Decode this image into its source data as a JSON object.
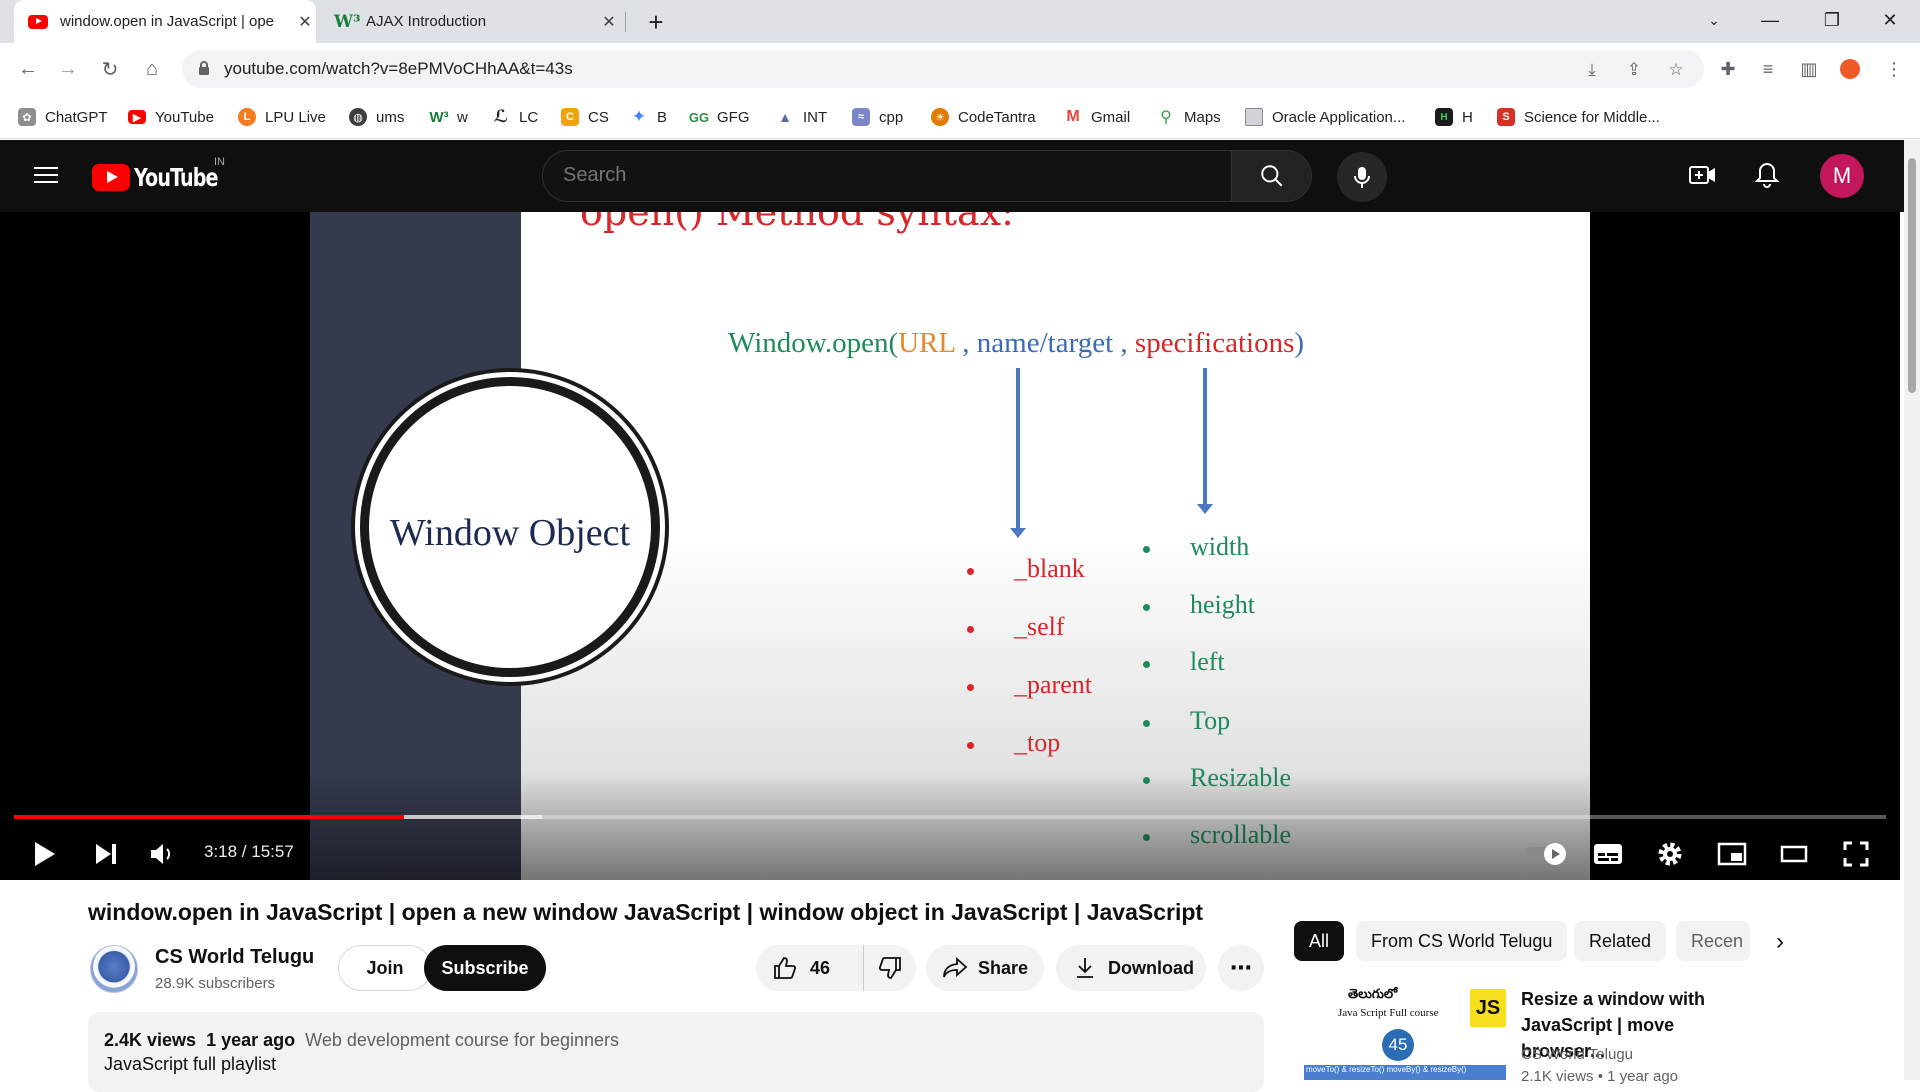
{
  "browser": {
    "tabs": [
      {
        "title": "window.open in JavaScript | ope",
        "active": true
      },
      {
        "title": "AJAX Introduction",
        "active": false
      }
    ],
    "new_tab": "+",
    "url": "youtube.com/watch?v=8ePMVoCHhAA&t=43s",
    "bookmarks": [
      {
        "label": "ChatGPT",
        "icon": "chatgpt-icon",
        "color": "#6f6f6f"
      },
      {
        "label": "YouTube",
        "icon": "youtube-icon",
        "color": "#ff0000"
      },
      {
        "label": "LPU Live",
        "icon": "lpu-icon",
        "color": "#f47b20"
      },
      {
        "label": "ums",
        "icon": "globe-icon",
        "color": "#3c4043"
      },
      {
        "label": "w",
        "icon": "w3-icon",
        "color": "#1a7f37"
      },
      {
        "label": "LC",
        "icon": "leetcode-icon",
        "color": "#202124"
      },
      {
        "label": "CS",
        "icon": "cs-icon",
        "color": "#f0a30a"
      },
      {
        "label": "B",
        "icon": "bard-icon",
        "color": "#4285f4"
      },
      {
        "label": "GFG",
        "icon": "gfg-icon",
        "color": "#2f8d46"
      },
      {
        "label": "INT",
        "icon": "int-icon",
        "color": "#5b6e9c"
      },
      {
        "label": "cpp",
        "icon": "cpp-icon",
        "color": "#6a5acd"
      },
      {
        "label": "CodeTantra",
        "icon": "codetantra-icon",
        "color": "#e07b00"
      },
      {
        "label": "Gmail",
        "icon": "gmail-icon",
        "color": "#ea4335"
      },
      {
        "label": "Maps",
        "icon": "maps-icon",
        "color": "#34a853"
      },
      {
        "label": "Oracle Application...",
        "icon": "oracle-icon",
        "color": "#8a8a8a"
      },
      {
        "label": "H",
        "icon": "hackerrank-icon",
        "color": "#1b1b1b"
      },
      {
        "label": "Science for Middle...",
        "icon": "science-icon",
        "color": "#d93025"
      }
    ]
  },
  "youtube": {
    "logo": "YouTube",
    "region": "IN",
    "search_placeholder": "Search",
    "avatar_letter": "M",
    "avatar_color": "#c2185b"
  },
  "slide": {
    "title": "open() Method syntax:",
    "circle_label": "Window Object",
    "syntax": {
      "prefix": "Window.open(",
      "url": "URL",
      "sep1": " , ",
      "name": "name/target",
      "sep2": " , ",
      "spec": "specifications",
      "suffix": ")"
    },
    "targets": [
      "_blank",
      "_self",
      "_parent",
      "_top"
    ],
    "specs": [
      "width",
      "height",
      "left",
      "Top",
      "Resizable",
      "scrollable"
    ],
    "colors": {
      "red": "#d8262b",
      "green": "#1f8a5a",
      "blue": "#3d6ab5",
      "orange": "#e38a2f"
    }
  },
  "player": {
    "time": "3:18 / 15:57",
    "progress_fraction": 0.2086
  },
  "video": {
    "title": "window.open in JavaScript | open a new window JavaScript | window object in JavaScript | JavaScript",
    "channel": "CS World Telugu",
    "subscribers": "28.9K subscribers",
    "join_label": "Join",
    "subscribe_label": "Subscribe",
    "likes": "46",
    "share_label": "Share",
    "download_label": "Download",
    "views": "2.4K views",
    "age": "1 year ago",
    "description_line1": "Web development course for beginners",
    "description_line2": "JavaScript full playlist"
  },
  "chips": [
    "All",
    "From CS World Telugu",
    "Related",
    "Recen"
  ],
  "recommendation": {
    "title": "Resize a window with JavaScript | move browser...",
    "channel": "CS World Telugu",
    "meta": "2.1K views • 1 year ago",
    "thumb_top": "తెలుగులో",
    "thumb_sub": "Java Script Full course",
    "thumb_badge": "JS",
    "thumb_num": "45",
    "thumb_bottom": "moveTo() & resizeTo() moveBy() & resizeBy()"
  }
}
